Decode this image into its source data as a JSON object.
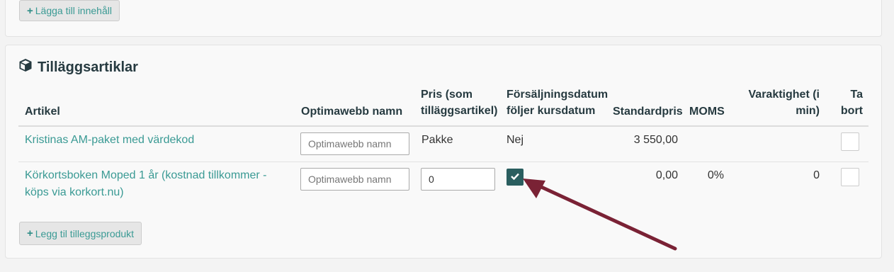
{
  "content_section": {
    "add_button_label": "Lägga till innehåll"
  },
  "addons": {
    "title": "Tilläggsartiklar",
    "columns": {
      "article": "Artikel",
      "optimaweb_name": "Optimawebb namn",
      "price_line1": "Pris (som",
      "price_line2": "tilläggsartikel)",
      "sale_date_line1": "Försäljningsdatum",
      "sale_date_line2": "följer kursdatum",
      "standard_price": "Standardpris",
      "vat": "MOMS",
      "duration_line1": "Varaktighet (i",
      "duration_line2": "min)",
      "remove_line1": "Ta",
      "remove_line2": "bort"
    },
    "rows": [
      {
        "article": "Kristinas AM-paket med värdekod",
        "name_placeholder": "Optimawebb namn",
        "price_text": "Pakke",
        "follows_course_date": "Nej",
        "standard_price": "3 550,00",
        "vat": "",
        "duration": ""
      },
      {
        "article_line1": "Körkortsboken Moped 1 år (kostnad tillkommer -",
        "article_line2": "köps via korkort.nu)",
        "name_placeholder": "Optimawebb namn",
        "price_value": "0",
        "follows_course_date_checked": true,
        "standard_price": "0,00",
        "vat": "0%",
        "duration": "0"
      }
    ],
    "add_button_label": "Legg til tilleggsprodukt"
  },
  "colors": {
    "link": "#3a9a94",
    "checkbox_checked": "#2a5e5f",
    "arrow": "#7a2235"
  }
}
